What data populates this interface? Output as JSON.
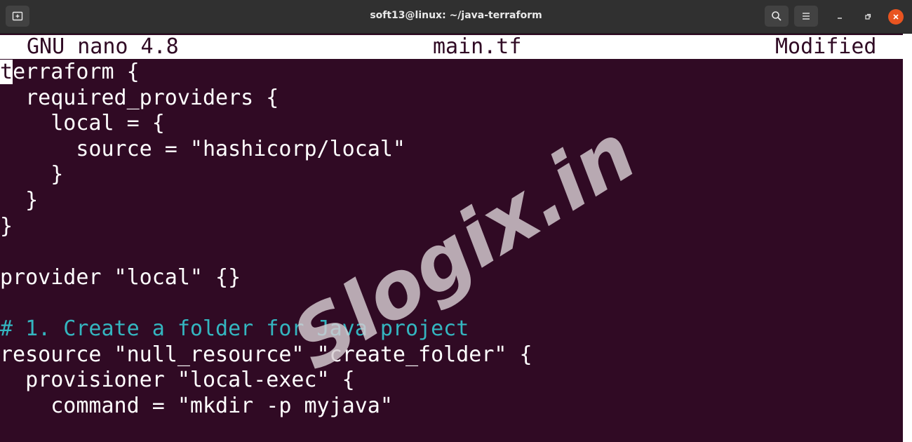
{
  "window": {
    "title": "soft13@linux: ~/java-terraform",
    "accent_close_color": "#e95420",
    "terminal_bg": "#300a24"
  },
  "titlebar_icons": {
    "new_tab": "new-tab-icon",
    "search": "search-icon",
    "menu": "hamburger-menu-icon",
    "minimize": "minimize-icon",
    "maximize": "maximize-icon",
    "close": "close-icon"
  },
  "nano": {
    "version_label": "GNU nano 4.8",
    "filename": "main.tf",
    "status": "Modified"
  },
  "code": {
    "cursor_char": "t",
    "line_1_rest": "erraform {",
    "line_2": "  required_providers {",
    "line_3": "    local = {",
    "line_4": "      source = \"hashicorp/local\"",
    "line_5": "    }",
    "line_6": "  }",
    "line_7": "}",
    "line_8": "",
    "line_9": "provider \"local\" {}",
    "line_10": "",
    "line_11_comment": "# 1. Create a folder for Java project",
    "line_12": "resource \"null_resource\" \"create_folder\" {",
    "line_13": "  provisioner \"local-exec\" {",
    "line_14": "    command = \"mkdir -p myjava\""
  },
  "watermark": {
    "text": "Slogix.in"
  }
}
